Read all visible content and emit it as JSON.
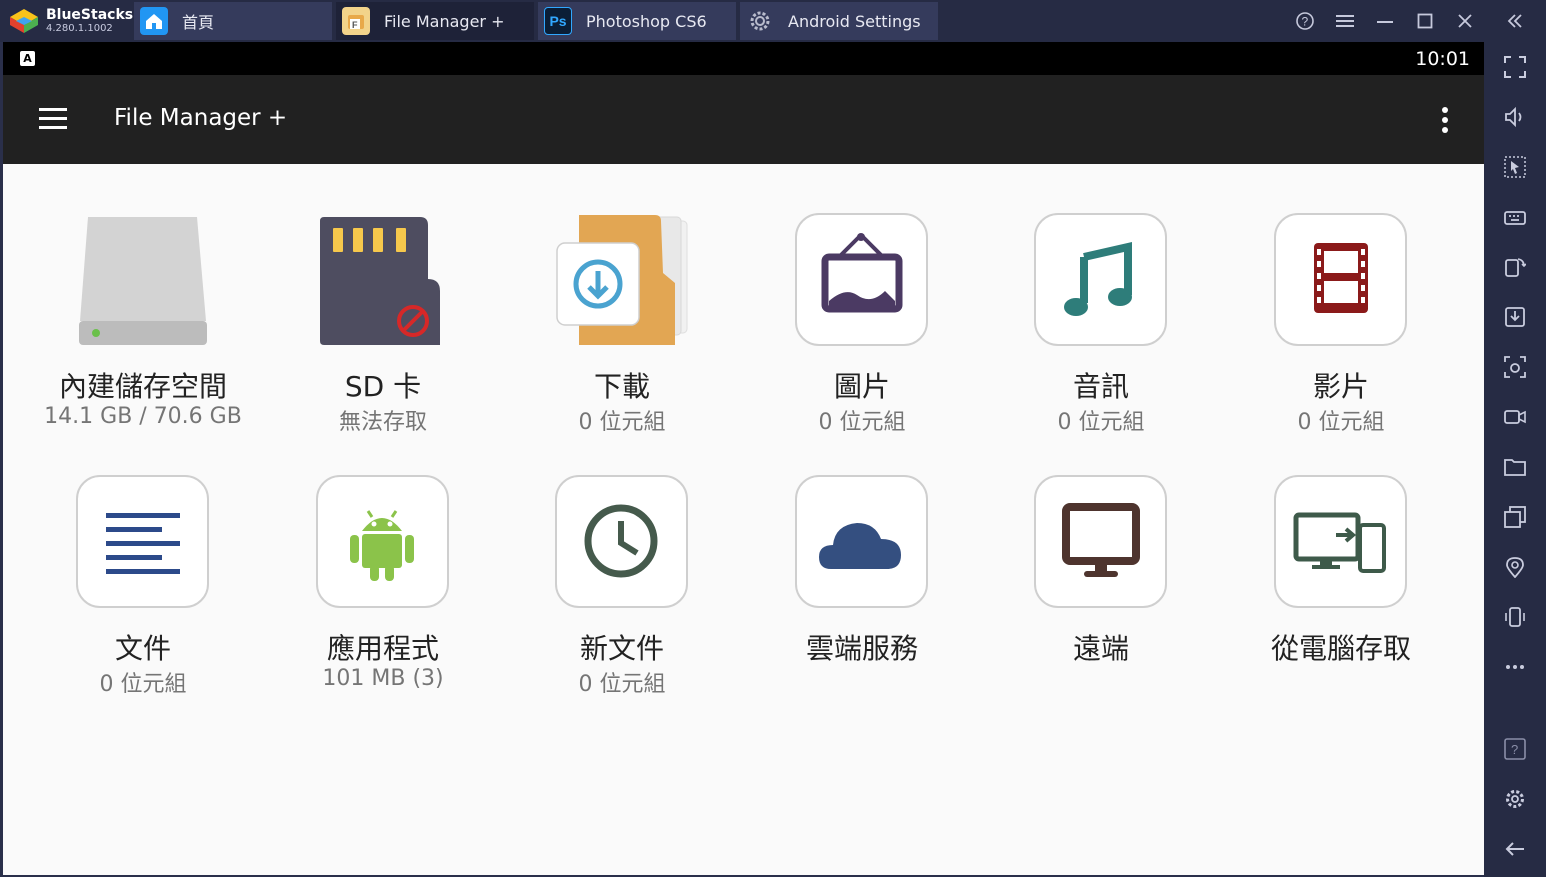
{
  "brand": {
    "name": "BlueStacks",
    "version": "4.280.1.1002"
  },
  "tabs": [
    {
      "label": "首頁"
    },
    {
      "label": "File Manager +"
    },
    {
      "label": "Photoshop CS6"
    },
    {
      "label": "Android Settings"
    }
  ],
  "status": {
    "time": "10:01",
    "indicator": "A"
  },
  "appbar": {
    "title": "File Manager +"
  },
  "tiles": [
    {
      "label": "內建儲存空間",
      "sub": "14.1 GB / 70.6 GB"
    },
    {
      "label": "SD 卡",
      "sub": "無法存取"
    },
    {
      "label": "下載",
      "sub": "0 位元組"
    },
    {
      "label": "圖片",
      "sub": "0 位元組"
    },
    {
      "label": "音訊",
      "sub": "0 位元組"
    },
    {
      "label": "影片",
      "sub": "0 位元組"
    },
    {
      "label": "文件",
      "sub": "0 位元組"
    },
    {
      "label": "應用程式",
      "sub": "101 MB (3)"
    },
    {
      "label": "新文件",
      "sub": "0 位元組"
    },
    {
      "label": "雲端服務",
      "sub": ""
    },
    {
      "label": "遠端",
      "sub": ""
    },
    {
      "label": "從電腦存取",
      "sub": ""
    }
  ],
  "icons": {
    "tab_home": "home-icon",
    "tab_fm": "file-manager-app-icon",
    "tab_ps": "photoshop-app-icon",
    "tab_settings": "gear-icon"
  },
  "colors": {
    "titlebar": "#262b44",
    "appbar": "#212121",
    "background": "#fafafa",
    "accent_purple": "#4b3a63",
    "accent_teal": "#2e7d7a",
    "accent_red": "#8b1a1a",
    "accent_navy": "#2c4a8a"
  }
}
